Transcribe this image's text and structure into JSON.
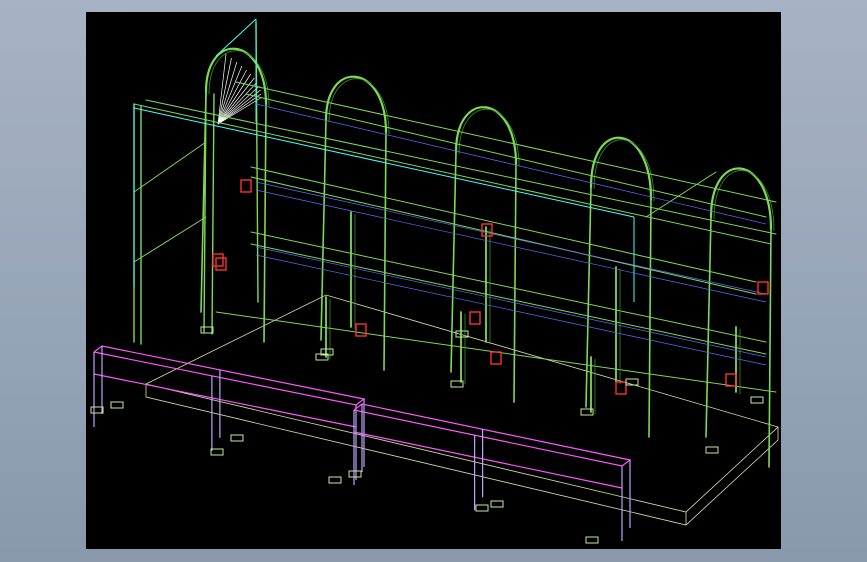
{
  "app": {
    "background_color": "#9aa8bb",
    "viewport_background": "#000000"
  },
  "model_view": {
    "description_colors": {
      "frame": "#7ed957",
      "frame_dark": "#3e8e2a",
      "glass_edge": "#33ffff",
      "bench": "#ff55ff",
      "connector": "#ff3030",
      "foot_plate": "#c8e6a0",
      "slab": "#e8f0c0",
      "fan": "#ffffff",
      "wire_blue": "#5a6cff"
    }
  }
}
